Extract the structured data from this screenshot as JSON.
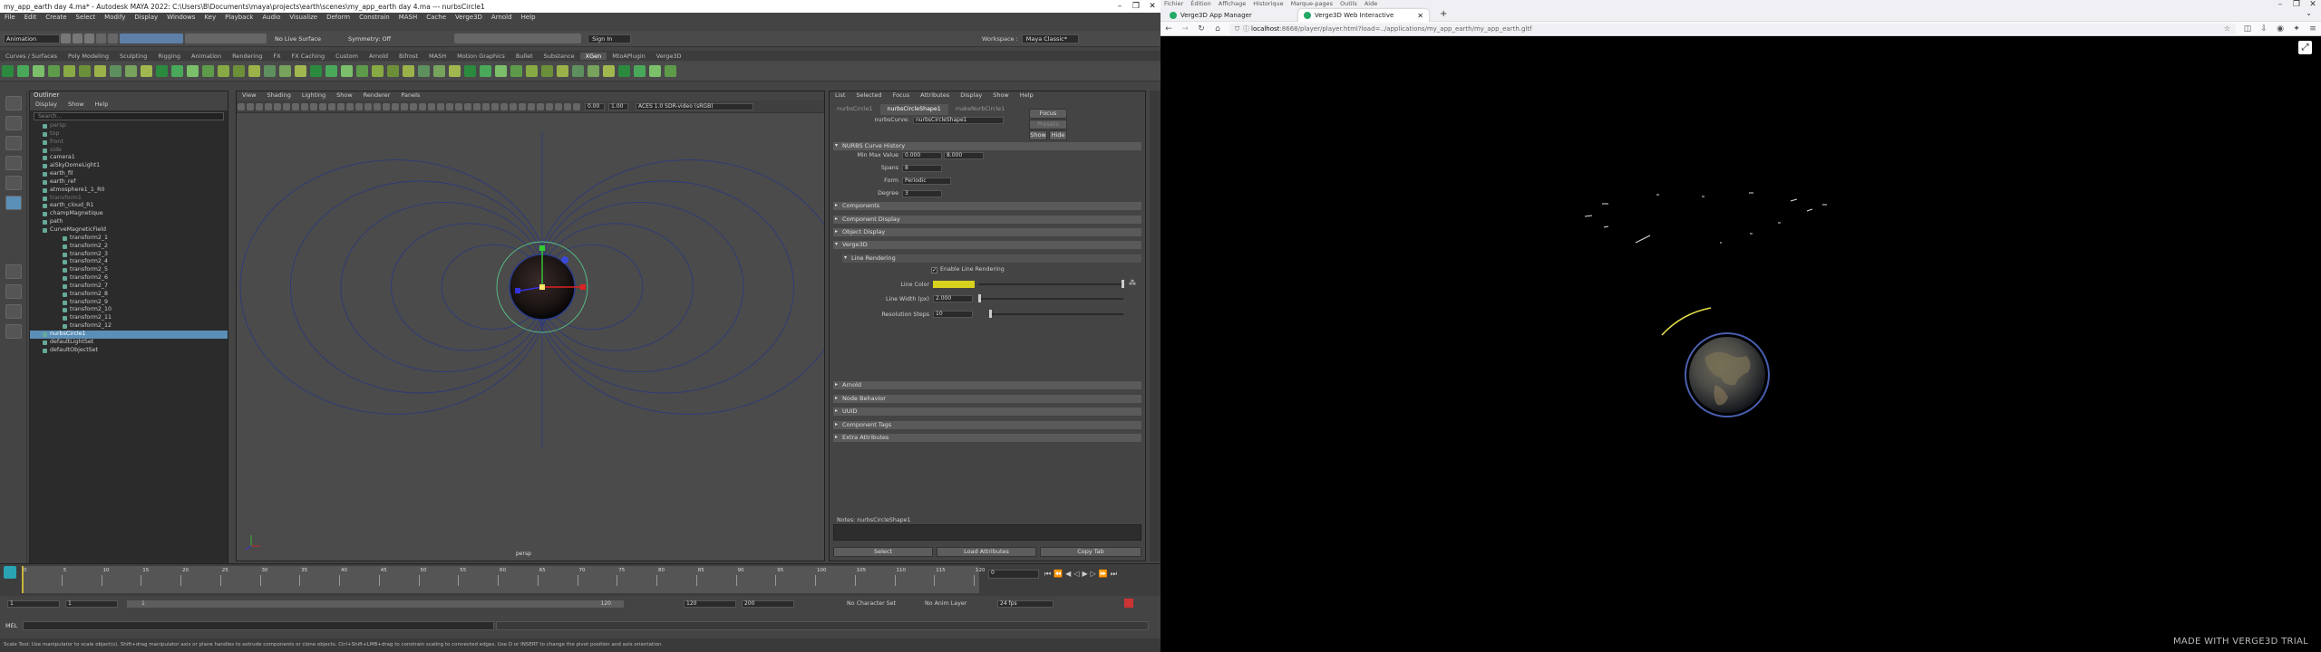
{
  "maya": {
    "title": "my_app_earth day 4.ma* - Autodesk MAYA 2022: C:\\Users\\B\\Documents\\maya\\projects\\earth\\scenes\\my_app_earth day 4.ma  ---  nurbsCircle1",
    "menu": [
      "File",
      "Edit",
      "Create",
      "Select",
      "Modify",
      "Display",
      "Windows",
      "Key",
      "Playback",
      "Audio",
      "Visualize",
      "Deform",
      "Constrain",
      "MASH",
      "Cache",
      "Verge3D",
      "Arnold",
      "Help"
    ],
    "workspace_label": "Workspace :",
    "workspace_value": "Maya Classic*",
    "mode_menu": "Animation",
    "no_live_surface": "No Live Surface",
    "symmetry": "Symmetry: Off",
    "sign_in": "Sign In",
    "shelf_tabs": [
      "Curves / Surfaces",
      "Poly Modeling",
      "Sculpting",
      "Rigging",
      "Animation",
      "Rendering",
      "FX",
      "FX Caching",
      "Custom",
      "Arnold",
      "Bifrost",
      "MASH",
      "Motion Graphics",
      "Bullet",
      "Substance",
      "XGen",
      "MtoAPlugin",
      "Verge3D"
    ],
    "shelf_active": "XGen",
    "outliner": {
      "title": "Outliner",
      "menu": [
        "Display",
        "Show",
        "Help"
      ],
      "search": "Search...",
      "items": [
        {
          "label": "persp",
          "dim": true,
          "indent": false
        },
        {
          "label": "top",
          "dim": true,
          "indent": false
        },
        {
          "label": "front",
          "dim": true,
          "indent": false
        },
        {
          "label": "side",
          "dim": true,
          "indent": false
        },
        {
          "label": "camera1",
          "dim": false,
          "indent": false
        },
        {
          "label": "aiSkyDomeLight1",
          "dim": false,
          "indent": false
        },
        {
          "label": "earth_fil",
          "dim": false,
          "indent": false
        },
        {
          "label": "earth_ref",
          "dim": false,
          "indent": false
        },
        {
          "label": "atmosphere1_1_R0",
          "dim": false,
          "indent": false
        },
        {
          "label": "transform1",
          "dim": true,
          "indent": false
        },
        {
          "label": "earth_cloud_R1",
          "dim": false,
          "indent": false
        },
        {
          "label": "champMagnetique",
          "dim": false,
          "indent": false
        },
        {
          "label": "path",
          "dim": false,
          "indent": false
        },
        {
          "label": "CurveMagneticField",
          "dim": false,
          "indent": false
        },
        {
          "label": "transform2_1",
          "dim": false,
          "indent": true
        },
        {
          "label": "transform2_2",
          "dim": false,
          "indent": true
        },
        {
          "label": "transform2_3",
          "dim": false,
          "indent": true
        },
        {
          "label": "transform2_4",
          "dim": false,
          "indent": true
        },
        {
          "label": "transform2_5",
          "dim": false,
          "indent": true
        },
        {
          "label": "transform2_6",
          "dim": false,
          "indent": true
        },
        {
          "label": "transform2_7",
          "dim": false,
          "indent": true
        },
        {
          "label": "transform2_8",
          "dim": false,
          "indent": true
        },
        {
          "label": "transform2_9",
          "dim": false,
          "indent": true
        },
        {
          "label": "transform2_10",
          "dim": false,
          "indent": true
        },
        {
          "label": "transform2_11",
          "dim": false,
          "indent": true
        },
        {
          "label": "transform2_12",
          "dim": false,
          "indent": true
        },
        {
          "label": "nurbsCircle1",
          "dim": false,
          "indent": false,
          "selected": true
        },
        {
          "label": "defaultLightSet",
          "dim": false,
          "indent": false
        },
        {
          "label": "defaultObjectSet",
          "dim": false,
          "indent": false
        }
      ]
    },
    "viewport": {
      "menu": [
        "View",
        "Shading",
        "Lighting",
        "Show",
        "Renderer",
        "Panels"
      ],
      "exposure": "0.00",
      "gamma": "1.00",
      "colorspace": "ACES 1.0 SDR-video (sRGB)",
      "camera_label": "persp"
    },
    "attr": {
      "menu": [
        "List",
        "Selected",
        "Focus",
        "Attributes",
        "Display",
        "Show",
        "Help"
      ],
      "tabs": [
        "nurbsCircle1",
        "nurbsCircleShape1",
        "makeNurbCircle1"
      ],
      "active_tab": "nurbsCircleShape1",
      "node_label": "nurbsCurve:",
      "node_value": "nurbsCircleShape1",
      "focus_btn": "Focus",
      "presets_btn": "Presets",
      "show_btn": "Show",
      "hide_btn": "Hide",
      "history_section": "NURBS Curve History",
      "min_max_label": "Min Max Value",
      "min_value": "0.000",
      "max_value": "8.000",
      "spans_label": "Spans",
      "spans_value": "8",
      "form_label": "Form",
      "form_value": "Periodic",
      "degree_label": "Degree",
      "degree_value": "3",
      "sections_a": [
        "Components",
        "Component Display",
        "Object Display"
      ],
      "verge3d_section": "Verge3D",
      "line_rendering": "Line Rendering",
      "enable_line": "Enable Line Rendering",
      "line_color_label": "Line Color",
      "line_color": "#d8d21f",
      "line_width_label": "Line Width (px)",
      "line_width_value": "2.000",
      "resolution_label": "Resolution Steps",
      "resolution_value": "10",
      "sections_b": [
        "Arnold",
        "Node Behavior",
        "UUID",
        "Component Tags",
        "Extra Attributes"
      ],
      "notes_label": "Notes:  nurbsCircleShape1",
      "select_btn": "Select",
      "load_btn": "Load Attributes",
      "copy_btn": "Copy Tab"
    },
    "timeline": {
      "ticks": [
        "0",
        "5",
        "10",
        "15",
        "20",
        "25",
        "30",
        "35",
        "40",
        "45",
        "50",
        "55",
        "60",
        "65",
        "70",
        "75",
        "80",
        "85",
        "90",
        "95",
        "100",
        "105",
        "110",
        "115",
        "120"
      ],
      "current_frame": "0",
      "range_start": "1",
      "range_inner_start": "1",
      "range_inner_start_b": "1",
      "range_inner_end": "120",
      "range_end": "120",
      "range_end_b": "200",
      "char_set": "No Character Set",
      "anim_layer": "No Anim Layer",
      "fps": "24 fps"
    },
    "cmd_label": "MEL",
    "help_line": "Scale Tool: Use manipulator to scale object(s). Shift+drag manipulator axis or plane handles to extrude components or clone objects. Ctrl+Shift+LMB+drag to constrain scaling to connected edges. Use D or INSERT to change the pivot position and axis orientation."
  },
  "firefox": {
    "top_menu": [
      "Fichier",
      "Édition",
      "Affichage",
      "Historique",
      "Marque-pages",
      "Outils",
      "Aide"
    ],
    "tabs": [
      {
        "label": "Verge3D App Manager",
        "active": false
      },
      {
        "label": "Verge3D Web Interactive",
        "active": true
      }
    ],
    "url_host": "localhost",
    "url_rest": ":8668/player/player.html?load=../applications/my_app_earth/my_app_earth.gltf",
    "watermark": "MADE WITH VERGE3D TRIAL"
  }
}
